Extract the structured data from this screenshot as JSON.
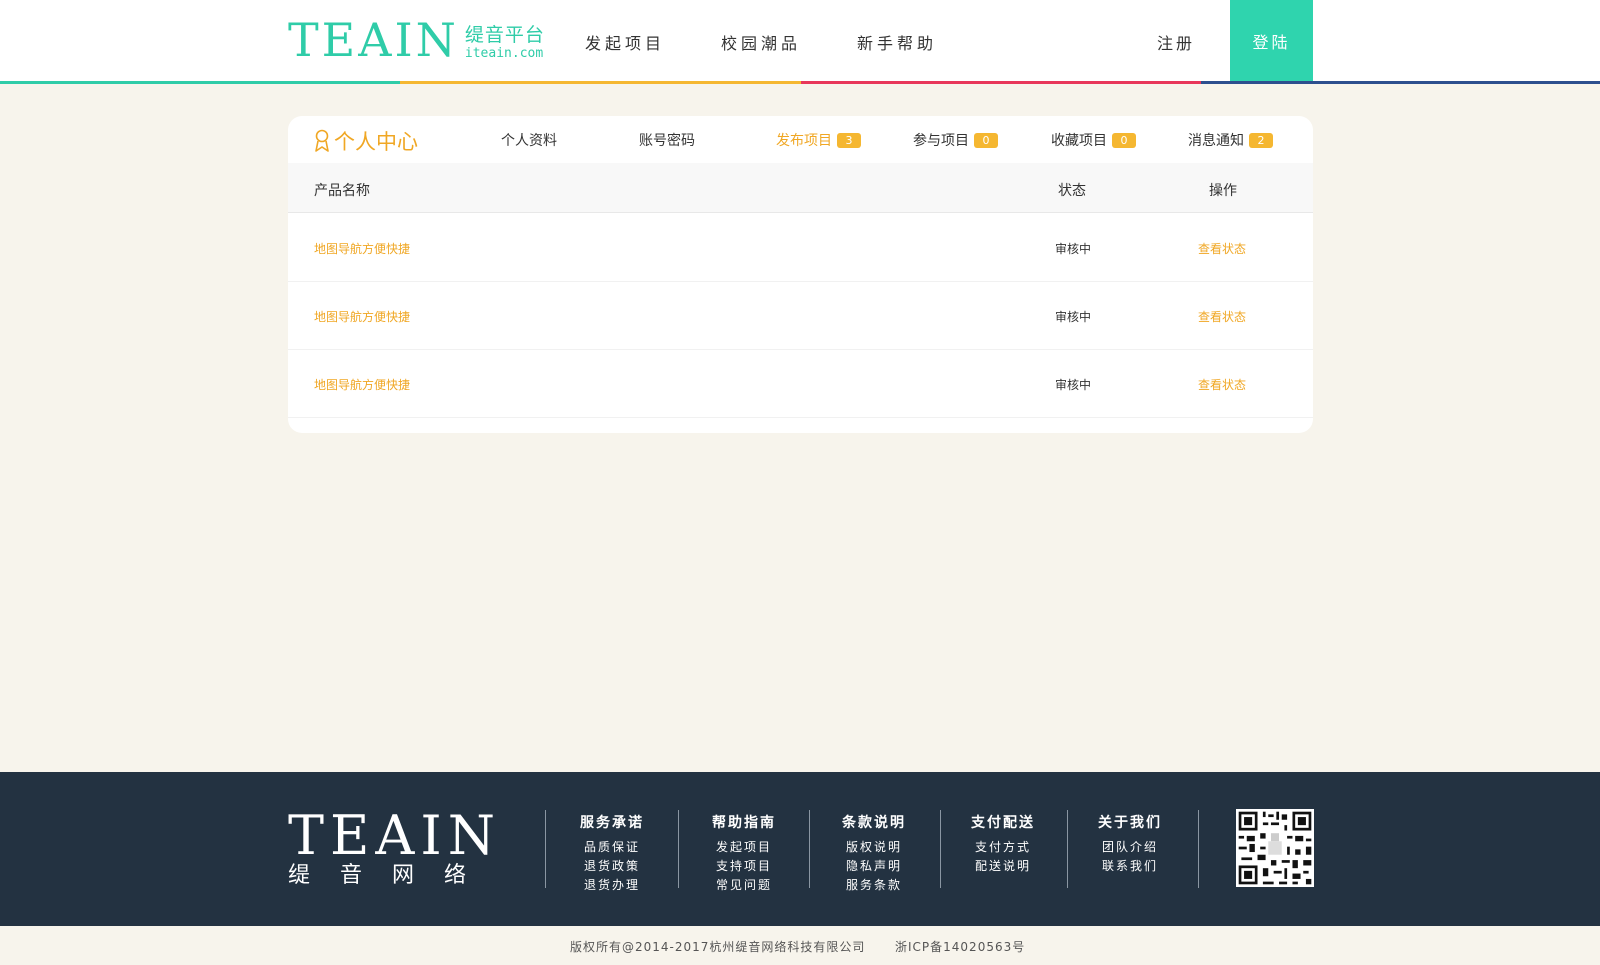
{
  "header": {
    "logo_text": "TEAIN",
    "logo_cn": "缇音平台",
    "logo_url": "iteain.com",
    "nav": [
      "发起项目",
      "校园潮品",
      "新手帮助"
    ],
    "register_label": "注册",
    "login_label": "登陆",
    "stripe_colors": [
      "#2fcca8",
      "#f5b731",
      "#e8375a",
      "#2d4f8e"
    ]
  },
  "user_center": {
    "title": "个人中心",
    "tabs": [
      {
        "label": "个人资料"
      },
      {
        "label": "账号密码"
      },
      {
        "label": "发布项目",
        "badge": "3",
        "active": true
      },
      {
        "label": "参与项目",
        "badge": "0"
      },
      {
        "label": "收藏项目",
        "badge": "0"
      },
      {
        "label": "消息通知",
        "badge": "2"
      }
    ]
  },
  "table": {
    "columns": [
      "产品名称",
      "状态",
      "操作"
    ],
    "rows": [
      {
        "name": "地图导航方便快捷",
        "status": "审核中",
        "action": "查看状态"
      },
      {
        "name": "地图导航方便快捷",
        "status": "审核中",
        "action": "查看状态"
      },
      {
        "name": "地图导航方便快捷",
        "status": "审核中",
        "action": "查看状态"
      }
    ]
  },
  "footer": {
    "logo_text": "TEAIN",
    "logo_cn": "缇音网络",
    "columns": [
      {
        "title": "服务承诺",
        "links": [
          "品质保证",
          "退货政策",
          "退货办理"
        ]
      },
      {
        "title": "帮助指南",
        "links": [
          "发起项目",
          "支持项目",
          "常见问题"
        ]
      },
      {
        "title": "条款说明",
        "links": [
          "版权说明",
          "隐私声明",
          "服务条款"
        ]
      },
      {
        "title": "支付配送",
        "links": [
          "支付方式",
          "配送说明"
        ]
      },
      {
        "title": "关于我们",
        "links": [
          "团队介绍",
          "联系我们"
        ]
      }
    ],
    "qr_icon": "qr-code-icon",
    "copyright": "版权所有@2014-2017杭州缇音网络科技有限公司",
    "icp": "浙ICP备14020563号"
  },
  "colors": {
    "accent": "#2fcca8",
    "orange": "#f0a724",
    "footer_bg": "#233241",
    "page_bg": "#f7f4ec"
  }
}
